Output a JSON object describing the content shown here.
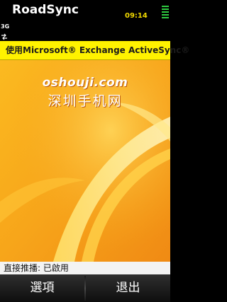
{
  "title_bar": {
    "app_title": "RoadSync",
    "clock": "09:14"
  },
  "status_bar": {
    "network_type": "3G"
  },
  "banner": {
    "text": "使用Microsoft® Exchange ActiveSync®"
  },
  "watermark": {
    "site": "oshouji.com",
    "chinese": "深圳手机网"
  },
  "status_line": {
    "text": "直接推播: 已啟用"
  },
  "softkeys": {
    "left": "選項",
    "right": "退出"
  }
}
